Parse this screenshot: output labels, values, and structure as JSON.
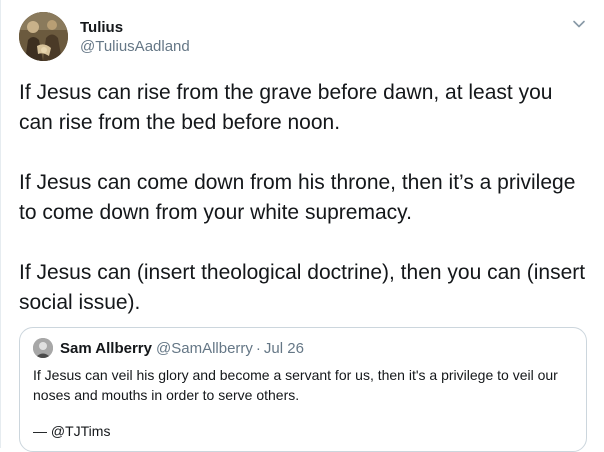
{
  "author": {
    "name": "Tulius",
    "handle": "@TuliusAadland"
  },
  "icons": {
    "menu": "chevron-down-icon"
  },
  "tweet": {
    "paragraphs": [
      "If Jesus can rise from the grave before dawn, at least you can rise from the bed before noon.",
      "If Jesus can come down from his throne, then it’s a privilege to come down from your white supremacy.",
      "If Jesus can (insert theological doctrine), then you can (insert social issue)."
    ]
  },
  "quoted_tweet": {
    "name": "Sam Allberry",
    "handle": "@SamAllberry",
    "separator": "·",
    "date": "Jul 26",
    "text": "If Jesus can veil his glory and become a servant for us, then it's a privilege to veil our noses and mouths in order to serve others.",
    "signature": "— @TJTims"
  },
  "colors": {
    "text": "#14171a",
    "secondary": "#657786",
    "border": "#ccd6dd"
  }
}
